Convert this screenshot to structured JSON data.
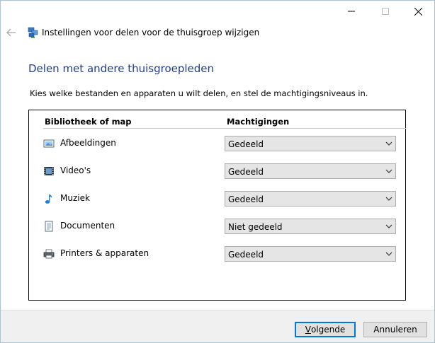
{
  "window": {
    "controls": {
      "minimize_icon": "minimize-icon",
      "maximize_icon": "maximize-icon",
      "close_icon": "close-icon"
    }
  },
  "nav": {
    "back_icon": "back-arrow-icon",
    "app_icon": "homegroup-icon",
    "title": "Instellingen voor delen voor de thuisgroep wijzigen"
  },
  "main": {
    "heading": "Delen met andere thuisgroepleden",
    "instruction": "Kies welke bestanden en apparaten u wilt delen, en stel de machtigingsniveaus in.",
    "columns": {
      "library": "Bibliotheek of map",
      "permissions": "Machtigingen"
    },
    "rows": [
      {
        "label": "Afbeeldingen",
        "icon": "pictures-icon",
        "permission": "Gedeeld"
      },
      {
        "label": "Video's",
        "icon": "videos-icon",
        "permission": "Gedeeld"
      },
      {
        "label": "Muziek",
        "icon": "music-icon",
        "permission": "Gedeeld"
      },
      {
        "label": "Documenten",
        "icon": "documents-icon",
        "permission": "Niet gedeeld"
      },
      {
        "label": "Printers & apparaten",
        "icon": "printer-icon",
        "permission": "Gedeeld"
      }
    ]
  },
  "footer": {
    "next_label_accel": "V",
    "next_label_rest": "olgende",
    "cancel_label": "Annuleren"
  },
  "colors": {
    "heading": "#1e3d8c",
    "primary_border": "#0078d7",
    "footer_bg": "#f0f0f0",
    "dropdown_bg": "#e5e5e5"
  }
}
